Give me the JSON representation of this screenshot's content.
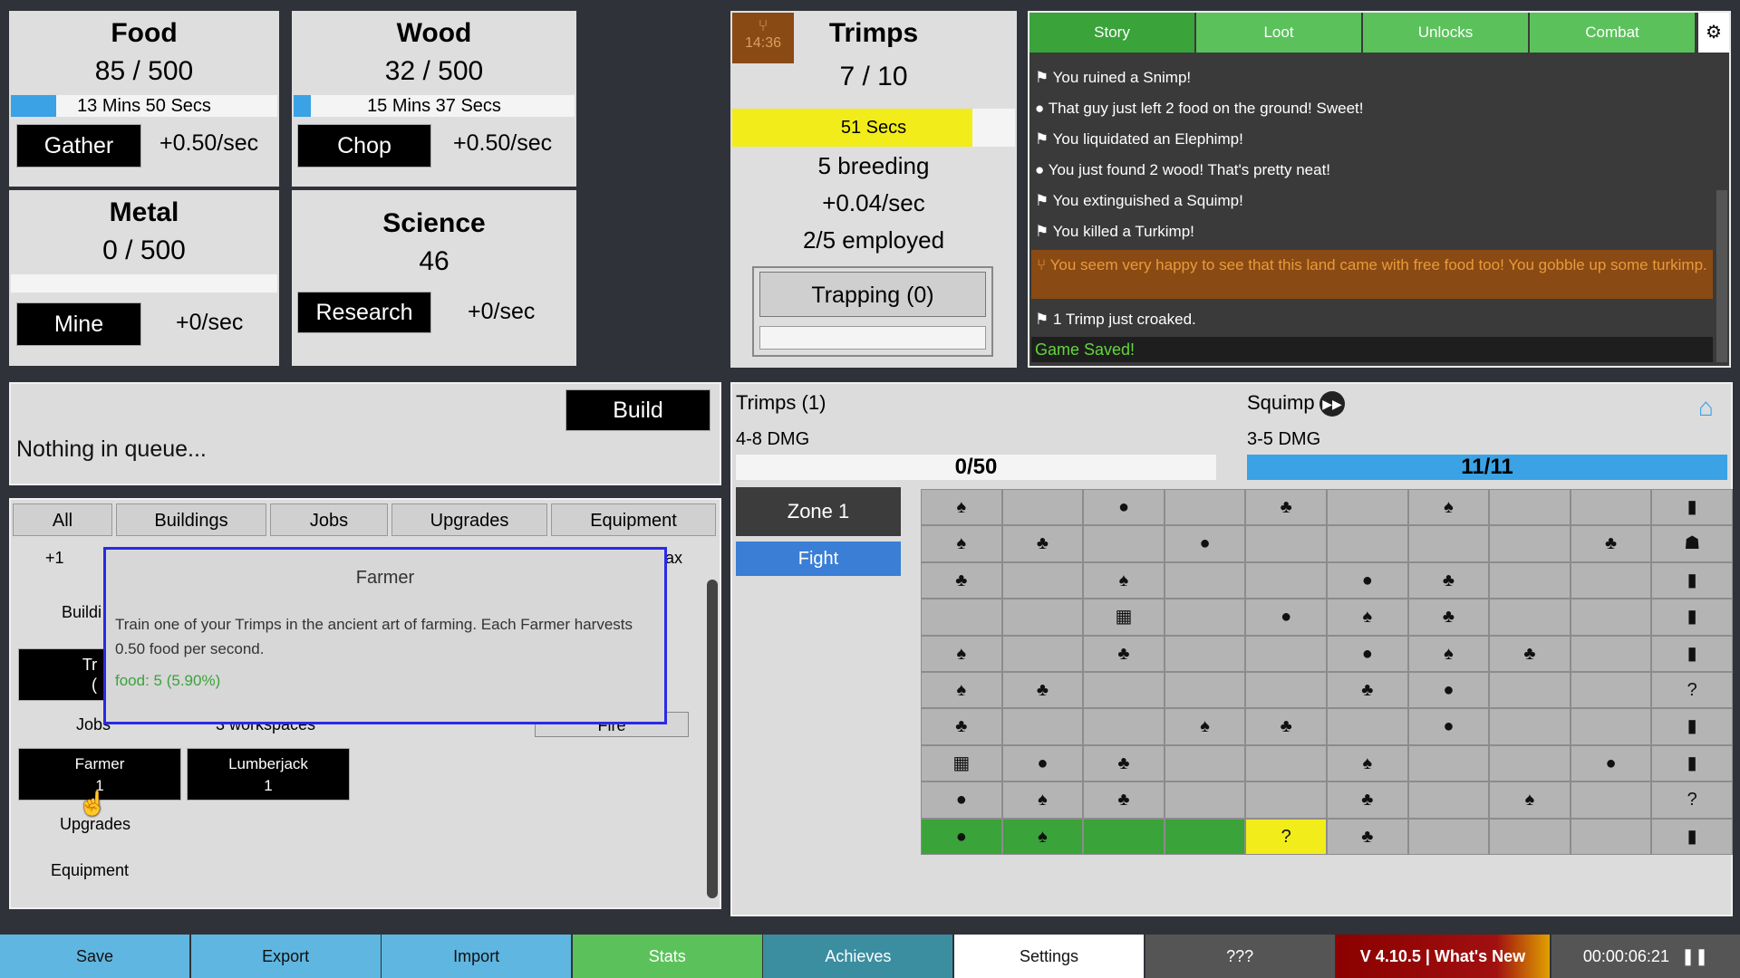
{
  "resources": {
    "food": {
      "title": "Food",
      "amount": "85 / 500",
      "timer": "13 Mins 50 Secs",
      "button": "Gather",
      "rate": "+0.50/sec",
      "fill": 0.17
    },
    "wood": {
      "title": "Wood",
      "amount": "32 / 500",
      "timer": "15 Mins 37 Secs",
      "button": "Chop",
      "rate": "+0.50/sec",
      "fill": 0.06
    },
    "metal": {
      "title": "Metal",
      "amount": "0 / 500",
      "button": "Mine",
      "rate": "+0/sec",
      "fill": 0
    },
    "science": {
      "title": "Science",
      "amount": "46",
      "button": "Research",
      "rate": "+0/sec"
    }
  },
  "trimps": {
    "title": "Trimps",
    "time": "14:36",
    "count": "7 / 10",
    "timer": "51 Secs",
    "fill": 0.85,
    "breeding": "5 breeding",
    "rate": "+0.04/sec",
    "employed": "2/5 employed",
    "trapping": "Trapping (0)"
  },
  "log": {
    "tabs": [
      "Story",
      "Loot",
      "Unlocks",
      "Combat"
    ],
    "lines": [
      {
        "icon": "⚑",
        "text": "You ruined a Snimp!"
      },
      {
        "icon": "●",
        "text": "That guy just left 2 food on the ground! Sweet!"
      },
      {
        "icon": "⚑",
        "text": "You liquidated an Elephimp!"
      },
      {
        "icon": "●",
        "text": "You just found 2 wood! That's pretty neat!"
      },
      {
        "icon": "⚑",
        "text": "You extinguished a Squimp!"
      },
      {
        "icon": "⚑",
        "text": "You killed a Turkimp!"
      }
    ],
    "highlight": "You seem very happy to see that this land came with free food too! You gobble up some turkimp.",
    "croak": "1 Trimp just croaked.",
    "saved": "Game Saved!"
  },
  "queue": {
    "build": "Build",
    "empty": "Nothing in queue..."
  },
  "buy": {
    "tabs": [
      "All",
      "Buildings",
      "Jobs",
      "Upgrades",
      "Equipment"
    ],
    "plus": "+1",
    "max": "ax",
    "buildings_label": "Buildi",
    "trap_label": "Tr",
    "trap_count": "(",
    "jobs_label": "Jobs",
    "workspaces": "3 workspaces",
    "fire": "Fire",
    "jobs": [
      {
        "name": "Farmer",
        "count": "1"
      },
      {
        "name": "Lumberjack",
        "count": "1"
      }
    ],
    "upgrades_label": "Upgrades",
    "equipment_label": "Equipment"
  },
  "tooltip": {
    "title": "Farmer",
    "body": "Train one of your Trimps in the ancient art of farming. Each Farmer harvests 0.50 food per second.",
    "cost": "food: 5 (5.90%)"
  },
  "battle": {
    "trimps_label": "Trimps (1)",
    "trimps_dmg": "4-8 DMG",
    "trimps_hp": "0/50",
    "trimps_hp_fill": 0,
    "enemy_label": "Squimp",
    "enemy_dmg": "3-5 DMG",
    "enemy_hp": "11/11",
    "enemy_hp_fill": 1,
    "zone": "Zone 1",
    "fight": "Fight"
  },
  "grid": [
    [
      "♠",
      "",
      "●",
      "",
      "♣",
      "",
      "♠",
      "",
      "",
      "▮"
    ],
    [
      "♠",
      "♣",
      "",
      "●",
      "",
      "",
      "",
      "",
      "♣",
      "☗"
    ],
    [
      "♣",
      "",
      "♠",
      "",
      "",
      "●",
      "♣",
      "",
      "",
      "▮"
    ],
    [
      "",
      "",
      "▦",
      "",
      "●",
      "♠",
      "♣",
      "",
      "",
      "▮"
    ],
    [
      "♠",
      "",
      "♣",
      "",
      "",
      "●",
      "♠",
      "♣",
      "",
      "▮"
    ],
    [
      "♠",
      "♣",
      "",
      "",
      "",
      "♣",
      "●",
      "",
      "",
      "?"
    ],
    [
      "♣",
      "",
      "",
      "♠",
      "♣",
      "",
      "●",
      "",
      "",
      "▮"
    ],
    [
      "▦",
      "●",
      "♣",
      "",
      "",
      "♠",
      "",
      "",
      "●",
      "▮"
    ],
    [
      "●",
      "♠",
      "♣",
      "",
      "",
      "♣",
      "",
      "♠",
      "",
      "?"
    ],
    [
      "●",
      "♠",
      "",
      "",
      "?",
      "♣",
      "",
      "",
      "",
      "▮"
    ]
  ],
  "footer": {
    "buttons": [
      "Save",
      "Export",
      "Import",
      "Stats",
      "Achieves",
      "Settings",
      "???"
    ],
    "version": "V 4.10.5 | What's New",
    "clock": "00:00:06:21"
  },
  "colors": {
    "blue": "#3aa2e5",
    "yellow": "#f2ec1a",
    "green": "#3aa33a",
    "log_bg": "#3a3a3a",
    "orange_log": "#8a4a14"
  }
}
